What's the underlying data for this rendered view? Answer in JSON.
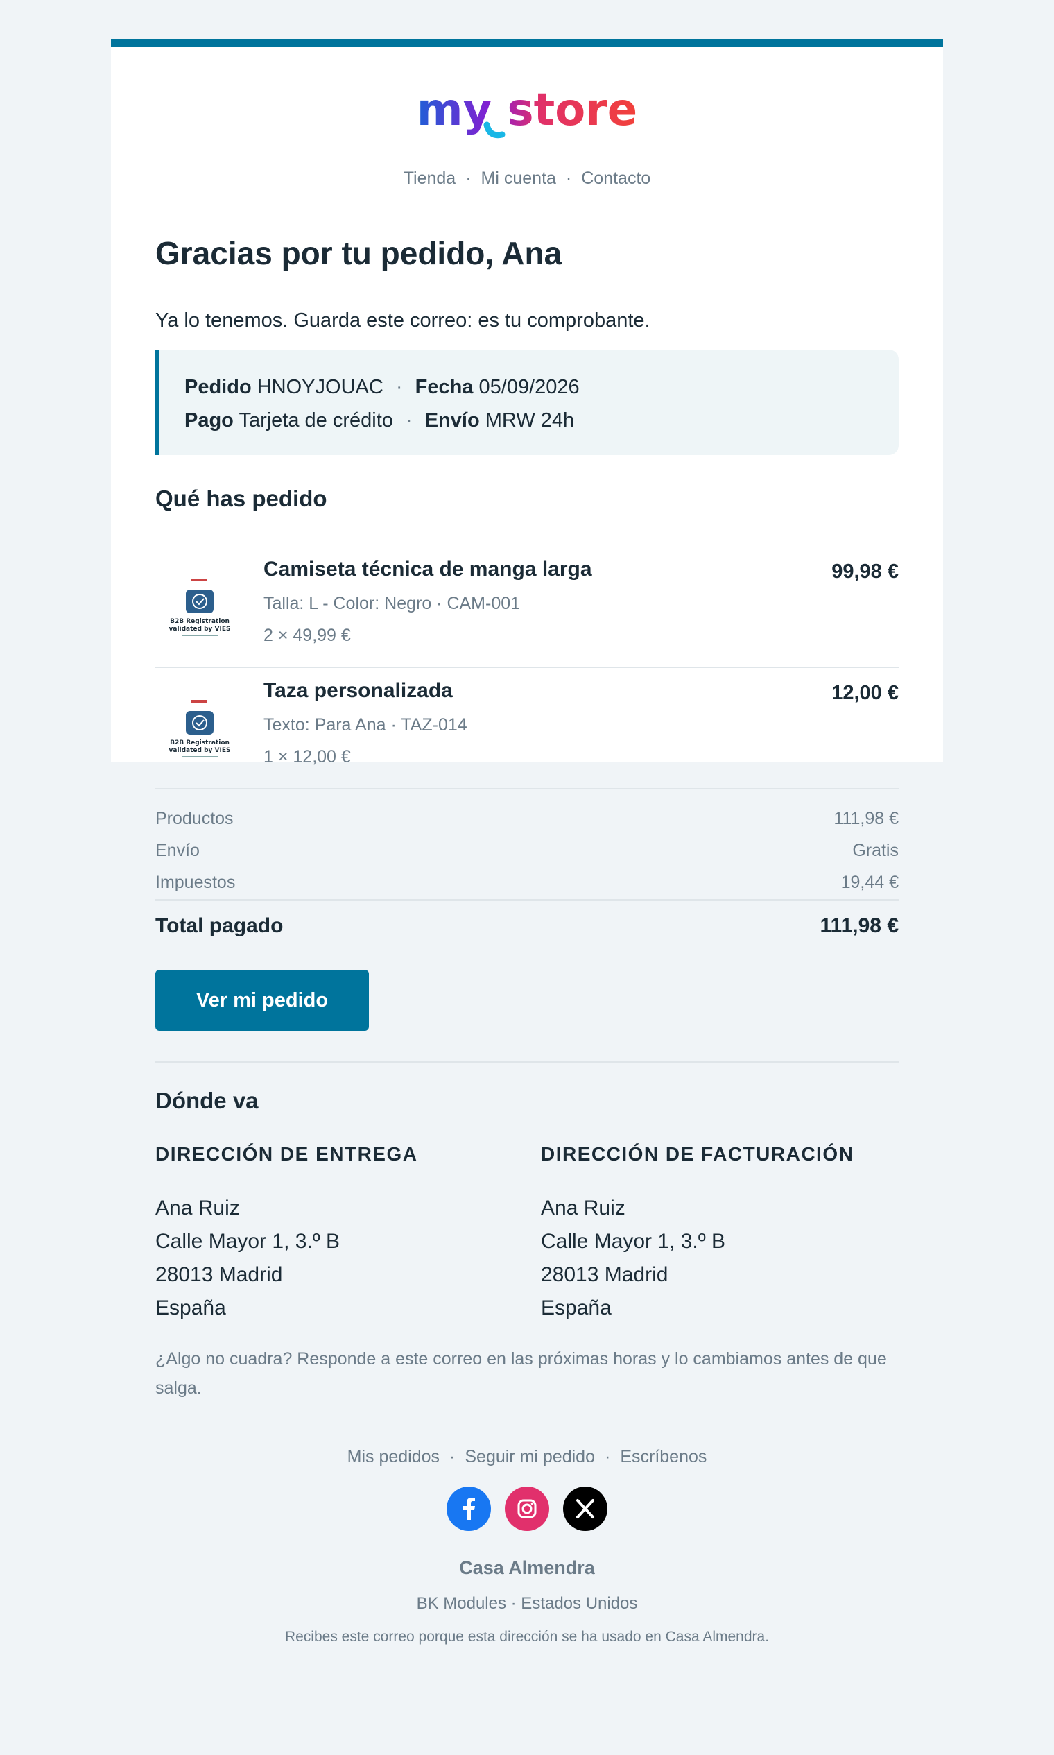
{
  "header": {
    "logo_text": "my store",
    "nav": [
      "Tienda",
      "Mi cuenta",
      "Contacto"
    ],
    "nav_separator": "·"
  },
  "greeting": {
    "title": "Gracias por tu pedido, Ana",
    "lead": "Ya lo tenemos. Guarda este correo: es tu comprobante."
  },
  "order_info": {
    "order_label": "Pedido",
    "order_value": "HNOYJOUAC",
    "date_label": "Fecha",
    "date_value": "05/09/2026",
    "payment_label": "Pago",
    "payment_value": "Tarjeta de crédito",
    "shipping_label": "Envío",
    "shipping_value": "MRW 24h",
    "separator": "·"
  },
  "items_section": {
    "title": "Qué has pedido",
    "items": [
      {
        "name": "Camiseta técnica de manga larga",
        "meta": "Talla: L - Color: Negro · CAM-001",
        "qty": "2 × 49,99 €",
        "price": "99,98 €",
        "thumb_icon": "vies-badge-icon",
        "thumb_lines": [
          "B2B Registration",
          "validated by VIES"
        ]
      },
      {
        "name": "Taza personalizada",
        "meta": "Texto: Para Ana · TAZ-014",
        "qty": "1 × 12,00 €",
        "price": "12,00 €",
        "thumb_icon": "vies-badge-icon",
        "thumb_lines": [
          "B2B Registration",
          "validated by VIES"
        ]
      }
    ]
  },
  "totals": {
    "rows": [
      {
        "label": "Productos",
        "value": "111,98 €"
      },
      {
        "label": "Envío",
        "value": "Gratis"
      },
      {
        "label": "Impuestos",
        "value": "19,44 €"
      }
    ],
    "total_label": "Total pagado",
    "total_value": "111,98 €"
  },
  "cta": {
    "label": "Ver mi pedido"
  },
  "addresses": {
    "title": "Dónde va",
    "shipping": {
      "heading": "DIRECCIÓN DE ENTREGA",
      "lines": [
        "Ana Ruiz",
        "Calle Mayor 1, 3.º B",
        "28013 Madrid",
        "España"
      ]
    },
    "billing": {
      "heading": "DIRECCIÓN DE FACTURACIÓN",
      "lines": [
        "Ana Ruiz",
        "Calle Mayor 1, 3.º B",
        "28013 Madrid",
        "España"
      ]
    }
  },
  "note": "¿Algo no cuadra? Responde a este correo en las próximas horas y lo cambiamos antes de que salga.",
  "footer": {
    "nav": [
      "Mis pedidos",
      "Seguir mi pedido",
      "Escríbenos"
    ],
    "social": [
      {
        "icon": "facebook-icon",
        "color": "#1877f2"
      },
      {
        "icon": "instagram-icon",
        "color": "#e1306c"
      },
      {
        "icon": "x-icon",
        "color": "#000000"
      }
    ],
    "brand": "Casa Almendra",
    "address": "BK Modules · Estados Unidos",
    "legal": "Recibes este correo porque esta dirección se ha usado en Casa Almendra."
  },
  "colors": {
    "accent": "#00749c",
    "background": "#f0f4f7",
    "muted": "#6b7b88",
    "text": "#1b2b36"
  }
}
